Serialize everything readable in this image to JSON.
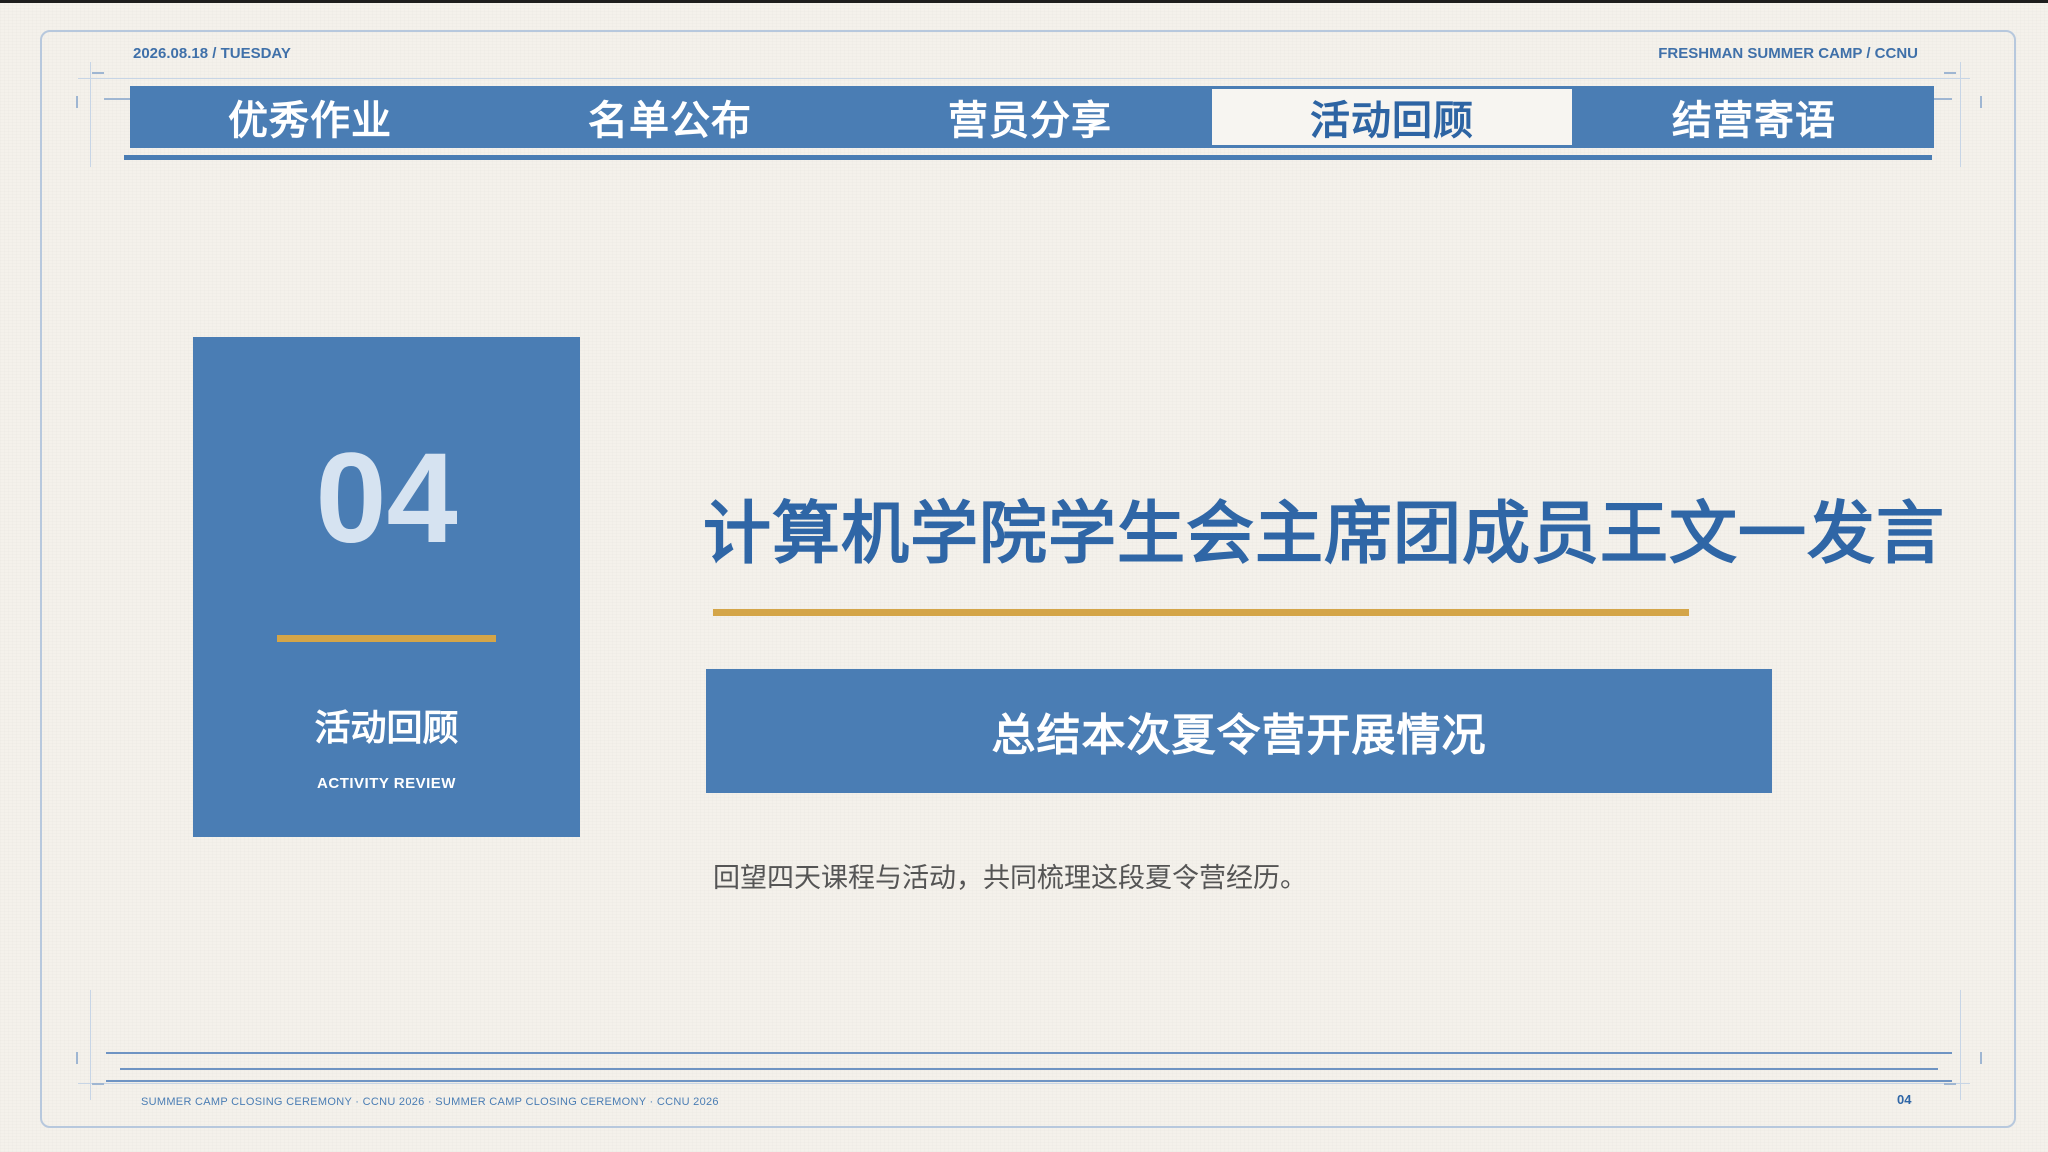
{
  "header": {
    "date": "2026.08.18 / TUESDAY",
    "camp": "FRESHMAN SUMMER CAMP / CCNU"
  },
  "nav": {
    "tabs": [
      {
        "label": "优秀作业"
      },
      {
        "label": "名单公布"
      },
      {
        "label": "营员分享"
      },
      {
        "label": "活动回顾",
        "active": true
      },
      {
        "label": "结营寄语"
      }
    ]
  },
  "section": {
    "number": "04",
    "title": "活动回顾",
    "subtitle": "ACTIVITY REVIEW"
  },
  "main": {
    "headline": "计算机学院学生会主席团成员王文一发言",
    "banner": "总结本次夏令营开展情况",
    "description": "回望四天课程与活动，共同梳理这段夏令营经历。"
  },
  "footer": {
    "text": "SUMMER CAMP CLOSING CEREMONY · CCNU 2026 · SUMMER CAMP CLOSING CEREMONY · CCNU 2026",
    "page": "04"
  },
  "colors": {
    "primary": "#4a7db4",
    "accent": "#d4a548",
    "background": "#f4f1eb"
  }
}
